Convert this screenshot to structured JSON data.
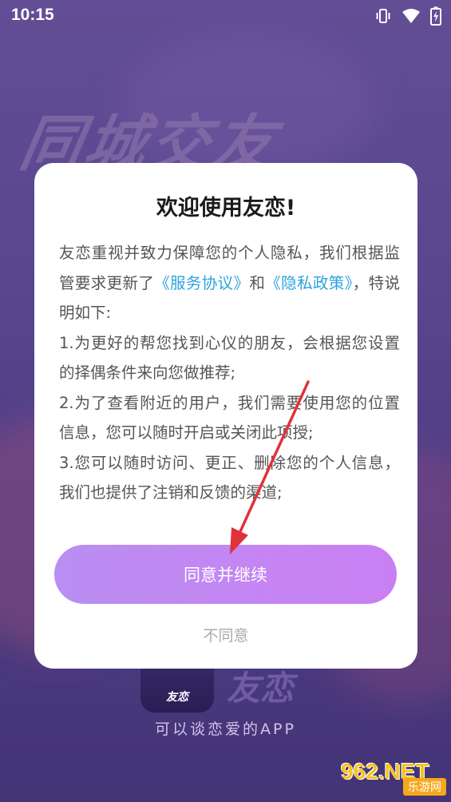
{
  "status_bar": {
    "time": "10:15",
    "icons": [
      "vibrate-icon",
      "wifi-icon",
      "battery-icon"
    ]
  },
  "background": {
    "headline": "同城交友",
    "app_logo_label": "友恋",
    "app_name": "友恋",
    "tagline": "可以谈恋爱的APP"
  },
  "dialog": {
    "title": "欢迎使用友恋!",
    "intro_prefix": "友恋重视并致力保障您的个人隐私，我们根据监管要求更新了",
    "service_link": "《服务协议》",
    "and_text": "和",
    "privacy_link": "《隐私政策》",
    "intro_suffix": "，特说明如下:",
    "points": [
      "1.为更好的帮您找到心仪的朋友，会根据您设置的择偶条件来向您做推荐;",
      "2.为了查看附近的用户，我们需要使用您的位置信息，您可以随时开启或关闭此项授;",
      "3.您可以随时访问、更正、删除您的个人信息，我们也提供了注销和反馈的渠道;"
    ],
    "agree_label": "同意并继续",
    "disagree_label": "不同意"
  },
  "watermark": {
    "main": "962.NET",
    "sub": "乐游网"
  },
  "colors": {
    "link": "#2aa4e0",
    "button_gradient_start": "#b98ef2",
    "button_gradient_end": "#c97ff2",
    "annotation_arrow": "#e0323a"
  }
}
